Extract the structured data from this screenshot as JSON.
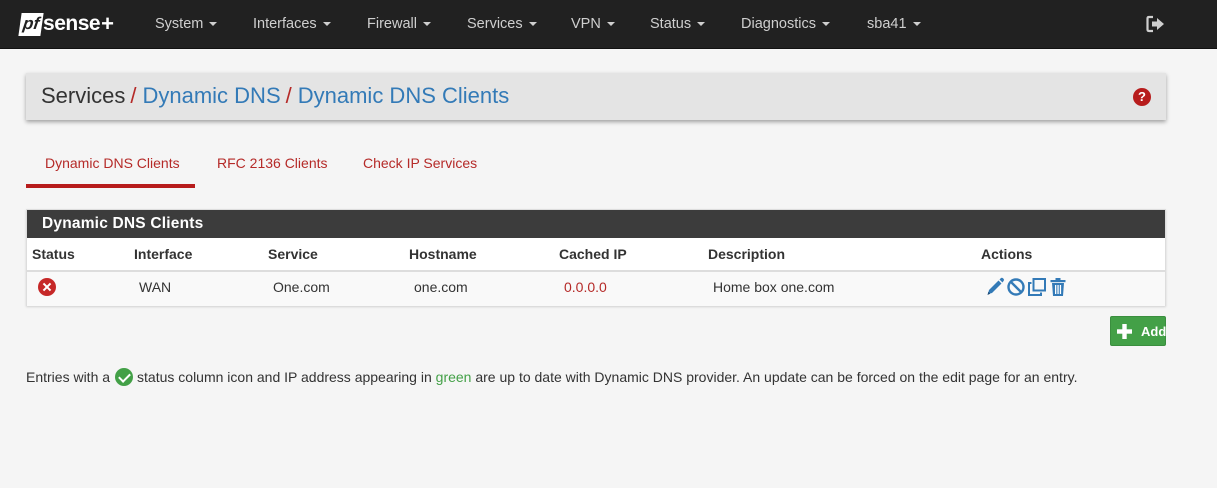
{
  "navbar": {
    "brand": {
      "pf": "pf",
      "sense": "sense",
      "plus": "+"
    },
    "items": [
      {
        "label": "System"
      },
      {
        "label": "Interfaces"
      },
      {
        "label": "Firewall"
      },
      {
        "label": "Services"
      },
      {
        "label": "VPN"
      },
      {
        "label": "Status"
      },
      {
        "label": "Diagnostics"
      },
      {
        "label": "sba41"
      }
    ],
    "logout_icon": "sign-out-icon"
  },
  "breadcrumb": {
    "root": "Services",
    "separator": "/",
    "level1": "Dynamic DNS",
    "level2": "Dynamic DNS Clients",
    "help_icon": "question-circle-icon",
    "help_glyph": "?"
  },
  "tabs": [
    {
      "label": "Dynamic DNS Clients",
      "active": true
    },
    {
      "label": "RFC 2136 Clients",
      "active": false
    },
    {
      "label": "Check IP Services",
      "active": false
    }
  ],
  "table": {
    "title": "Dynamic DNS Clients",
    "columns": [
      "Status",
      "Interface",
      "Service",
      "Hostname",
      "Cached IP",
      "Description",
      "Actions"
    ],
    "rows": [
      {
        "status_icon": "times-circle-icon",
        "interface": "WAN",
        "service": "One.com",
        "hostname": "one.com",
        "cached_ip": "0.0.0.0",
        "description": "Home box one.com",
        "actions": [
          "pencil-icon",
          "ban-icon",
          "clone-icon",
          "trash-icon"
        ]
      }
    ]
  },
  "add_button": {
    "label": "Add",
    "icon": "plus-icon"
  },
  "info": {
    "part1": "Entries with a",
    "icon": "check-circle-icon",
    "part2": "status column icon and IP address appearing in",
    "green_word": "green",
    "part3": "are up to date with Dynamic DNS provider. An update can be forced on the edit page for an entry."
  },
  "colors": {
    "navbar_bg": "#212121",
    "accent_red": "#b52a28",
    "link_blue": "#337ab7",
    "success_green": "#43a047",
    "table_header_bg": "#3c3c3c"
  }
}
